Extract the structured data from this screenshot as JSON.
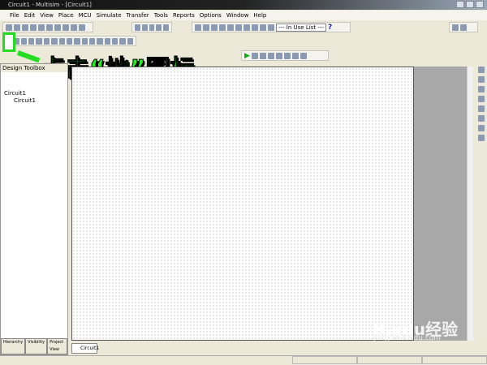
{
  "window": {
    "title": "Circuit1 - Multisim - [Circuit1]"
  },
  "menu": [
    "File",
    "Edit",
    "View",
    "Place",
    "MCU",
    "Simulate",
    "Transfer",
    "Tools",
    "Reports",
    "Options",
    "Window",
    "Help"
  ],
  "toolbar": {
    "in_use_list": "--- In Use List ---",
    "help": "?"
  },
  "annotation": {
    "text": "点击“地”图标",
    "highlight_color": "#22dd22"
  },
  "design_toolbox": {
    "title": "Design Toolbox",
    "tree": [
      "Circuit1",
      "Circuit1"
    ],
    "tabs": [
      "Hierarchy",
      "Visibility",
      "Project View"
    ]
  },
  "document_tab": "Circuit1",
  "watermark": {
    "brand": "Baidu经验",
    "url": "jingyan.baidu.com"
  }
}
